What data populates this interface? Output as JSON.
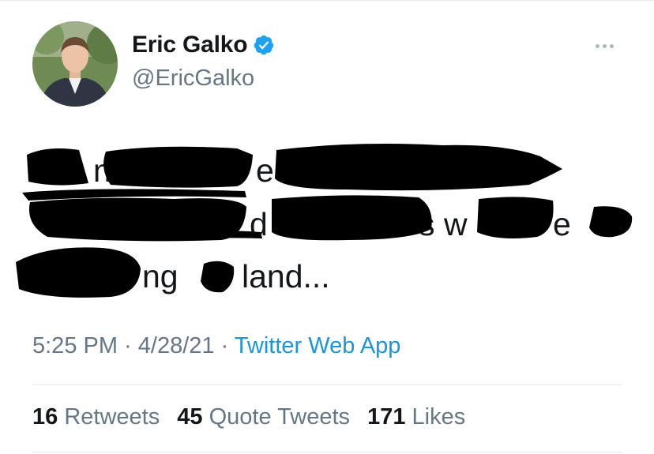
{
  "user": {
    "display_name": "Eric Galko",
    "handle": "@EricGalko",
    "verified": true
  },
  "tweet": {
    "visible_fragments": [
      "n",
      "e",
      "d",
      "s",
      "w",
      "e",
      "ng",
      "land..."
    ]
  },
  "meta": {
    "time": "5:25 PM",
    "separator": " · ",
    "date": "4/28/21",
    "source": "Twitter Web App"
  },
  "stats": [
    {
      "value": "16",
      "label": "Retweets"
    },
    {
      "value": "45",
      "label": "Quote Tweets"
    },
    {
      "value": "171",
      "label": "Likes"
    }
  ],
  "colors": {
    "text_primary": "#14171a",
    "text_secondary": "#657786",
    "link": "#1b95e0",
    "verified_badge": "#1da1f2",
    "redaction": "#000000"
  },
  "icons": {
    "verified": "verified-badge-icon",
    "more": "more-options-icon"
  }
}
